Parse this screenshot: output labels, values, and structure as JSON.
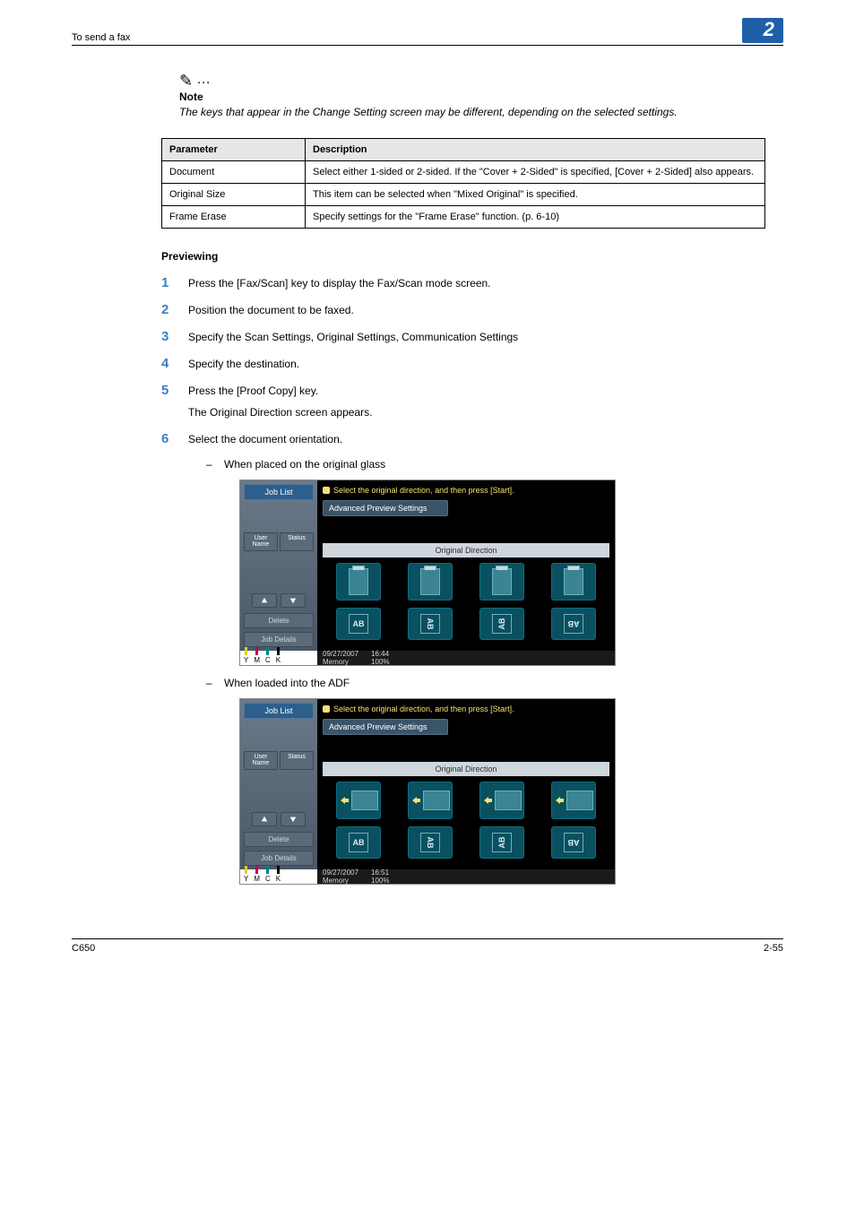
{
  "header": {
    "breadcrumb": "To send a fax",
    "chapter": "2"
  },
  "note": {
    "label": "Note",
    "text": "The keys that appear in the Change Setting screen may be different, depending on the selected settings."
  },
  "table": {
    "headers": [
      "Parameter",
      "Description"
    ],
    "rows": [
      {
        "param": "Document",
        "desc": "Select either 1-sided or 2-sided. If the \"Cover + 2-Sided\" is specified, [Cover + 2-Sided] also appears."
      },
      {
        "param": "Original Size",
        "desc": "This item can be selected when \"Mixed Original\" is specified."
      },
      {
        "param": "Frame Erase",
        "desc": "Specify settings for the \"Frame Erase\" function. (p. 6-10)"
      }
    ]
  },
  "section_heading": "Previewing",
  "steps": [
    {
      "n": "1",
      "text": "Press the [Fax/Scan] key to display the Fax/Scan mode screen."
    },
    {
      "n": "2",
      "text": "Position the document to be faxed."
    },
    {
      "n": "3",
      "text": "Specify the Scan Settings, Original Settings, Communication Settings"
    },
    {
      "n": "4",
      "text": "Specify the destination."
    },
    {
      "n": "5",
      "text": "Press the [Proof Copy] key.",
      "after": "The Original Direction screen appears."
    },
    {
      "n": "6",
      "text": "Select the document orientation."
    }
  ],
  "sub_bullets": {
    "glass": "When placed on the original glass",
    "adf": "When loaded into the ADF"
  },
  "screenshot": {
    "job_list": "Job List",
    "user_name": "User Name",
    "status": "Status",
    "delete": "Delete",
    "job_details": "Job Details",
    "instruction": "Select the original direction, and then press [Start].",
    "advanced": "Advanced Preview Settings",
    "orig_dir": "Original Direction",
    "ab": "AB",
    "datetime1_date": "09/27/2007",
    "datetime1_time": "16:44",
    "datetime2_date": "09/27/2007",
    "datetime2_time": "16:51",
    "memory": "Memory",
    "memval": "100%",
    "toner": {
      "y": "Y",
      "m": "M",
      "c": "C",
      "k": "K"
    }
  },
  "footer": {
    "model": "C650",
    "page": "2-55"
  }
}
